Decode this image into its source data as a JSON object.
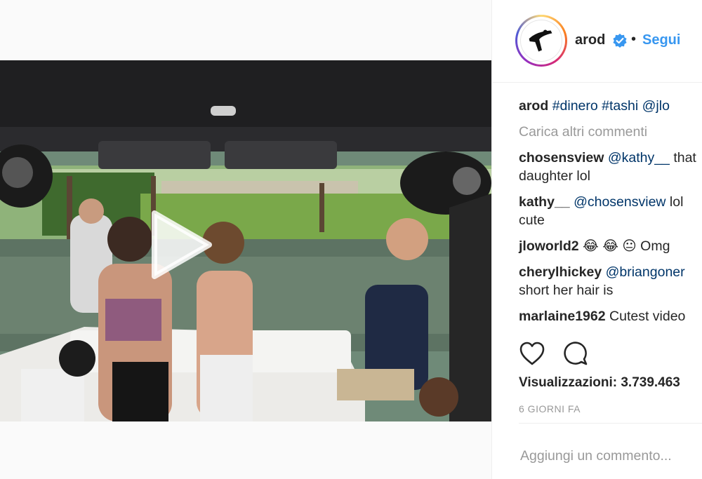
{
  "post": {
    "author": "arod",
    "follow_label": "Segui",
    "separator": "•",
    "caption": {
      "username": "arod",
      "hashtags": [
        "#dinero",
        "#tashi",
        "@jlo"
      ]
    },
    "load_more_label": "Carica altri commenti",
    "comments": [
      {
        "user": "chosensview",
        "line1_mention": "@kathy__",
        "line1_text": " that",
        "line2": "daughter lol"
      },
      {
        "user": "kathy__",
        "line1_mention": "@chosensview",
        "line1_text": " lol",
        "line2": "cute"
      },
      {
        "user": "jloworld2",
        "emoji": "😂 😂 😐",
        "text": " Omg"
      },
      {
        "user": "cherylhickey",
        "line1_mention": "@briangoner",
        "line1_text": "",
        "line2": "short her hair is"
      },
      {
        "user": "marlaine1962",
        "text": " Cutest video"
      }
    ],
    "views_label": "Visualizzazioni: 3.739.463",
    "time_ago": "6 GIORNI FA",
    "add_comment_placeholder": "Aggiungi un commento..."
  },
  "colors": {
    "link_blue": "#3897f0",
    "hashtag": "#003569",
    "muted": "#999999",
    "verified": "#3897f0"
  },
  "icons": {
    "play": "play-icon",
    "verified": "verified-badge-icon",
    "like": "heart-icon",
    "comment": "comment-icon"
  }
}
